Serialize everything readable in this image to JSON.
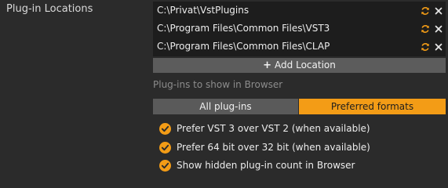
{
  "section_label": "Plug-in Locations",
  "locations": [
    {
      "path": "C:\\Privat\\VstPlugins",
      "rescan_icon": "refresh-icon",
      "remove_icon": "close-icon"
    },
    {
      "path": "C:\\Program Files\\Common Files\\VST3",
      "rescan_icon": "refresh-icon",
      "remove_icon": "close-icon"
    },
    {
      "path": "C:\\Program Files\\Common Files\\CLAP",
      "rescan_icon": "refresh-icon",
      "remove_icon": "close-icon"
    }
  ],
  "add_location": {
    "icon": "plus-icon",
    "label": "Add Location"
  },
  "browser_filter": {
    "caption": "Plug-ins to show in Browser",
    "options": [
      "All plug-ins",
      "Preferred formats"
    ],
    "selected": "Preferred formats"
  },
  "checkboxes": [
    {
      "label": "Prefer VST 3 over VST 2 (when available)",
      "checked": true
    },
    {
      "label": "Prefer 64 bit over 32 bit (when available)",
      "checked": true
    },
    {
      "label": "Show hidden plug-in count in Browser",
      "checked": true
    }
  ],
  "colors": {
    "accent": "#f39c16",
    "background": "#2b2b2b",
    "list_background": "#1d1d1d",
    "button": "#5c5c5c"
  }
}
